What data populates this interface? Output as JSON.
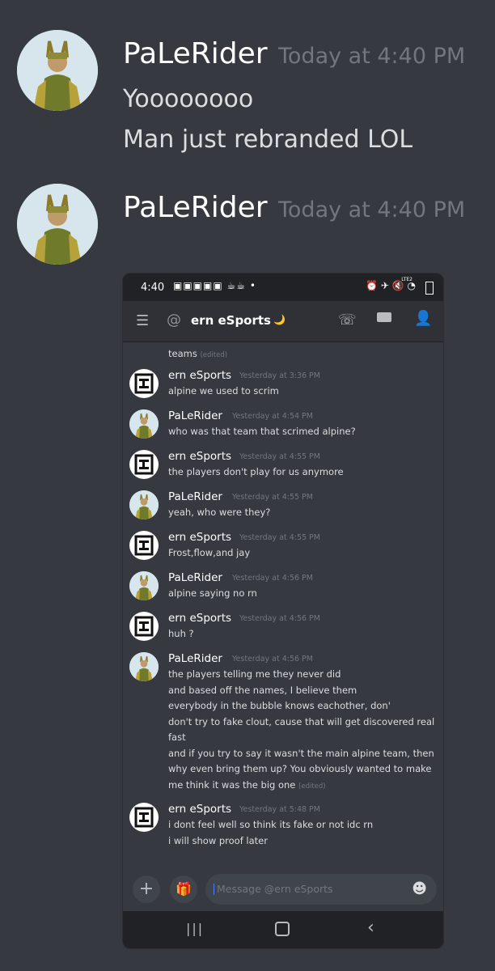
{
  "messages": [
    {
      "username": "PaLeRider",
      "timestamp": "Today at 4:40 PM",
      "lines": [
        "Yoooooooo",
        "Man just rebranded LOL"
      ]
    },
    {
      "username": "PaLeRider",
      "timestamp": "Today at 4:40 PM",
      "lines": []
    }
  ],
  "screenshot": {
    "status_time": "4:40",
    "status_lte": "LTE2",
    "channel_name": "ern eSports",
    "channel_emoji": "🌙",
    "truncated_message": "teams",
    "edited_label": "(edited)",
    "chat": [
      {
        "username": "ern eSports",
        "timestamp": "Yesterday at 3:36 PM",
        "lines": [
          "alpine we used to scrim"
        ]
      },
      {
        "username": "PaLeRider",
        "timestamp": "Yesterday at 4:54 PM",
        "lines": [
          "who was that team that scrimed alpine?"
        ]
      },
      {
        "username": "ern eSports",
        "timestamp": "Yesterday at 4:55 PM",
        "lines": [
          "the players don't play for us anymore"
        ]
      },
      {
        "username": "PaLeRider",
        "timestamp": "Yesterday at 4:55 PM",
        "lines": [
          "yeah, who were they?"
        ]
      },
      {
        "username": "ern eSports",
        "timestamp": "Yesterday at 4:55 PM",
        "lines": [
          "Frost,flow,and jay"
        ]
      },
      {
        "username": "PaLeRider",
        "timestamp": "Yesterday at 4:56 PM",
        "lines": [
          "alpine saying no rn"
        ]
      },
      {
        "username": "ern eSports",
        "timestamp": "Yesterday at 4:56 PM",
        "lines": [
          "huh ?"
        ]
      },
      {
        "username": "PaLeRider",
        "timestamp": "Yesterday at 4:56 PM",
        "lines": [
          "the players telling me they never did",
          "and based off the names, I believe them",
          "everybody in the bubble knows eachother, don'",
          "don't try to fake clout, cause that will get discovered real",
          "fast",
          "and if you try to say it wasn't the main alpine team, then",
          "why even bring them up? You obviously wanted to make",
          "me think it was the big one"
        ]
      },
      {
        "username": "ern eSports",
        "timestamp": "Yesterday at 5:48 PM",
        "lines": [
          "i dont feel well so think its fake or not idc rn",
          "i will show proof later"
        ]
      }
    ],
    "composer_placeholder": "Message @ern eSports"
  },
  "colors": {
    "background": "#36393f",
    "username": "#ffffff",
    "timestamp": "#72767d",
    "text": "#dcddde"
  }
}
